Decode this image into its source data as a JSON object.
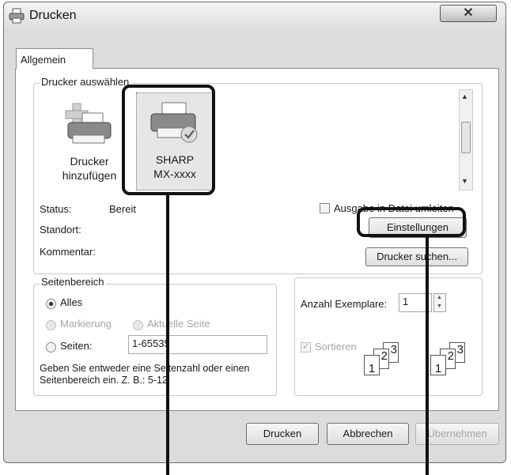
{
  "window": {
    "title": "Drucken"
  },
  "tab": {
    "label": "Allgemein"
  },
  "printer_group": {
    "label": "Drucker auswählen",
    "printers": [
      {
        "name_line1": "Drucker",
        "name_line2": "hinzufügen",
        "icon": "add-printer-icon"
      },
      {
        "name_line1": "SHARP",
        "name_line2": "MX-xxxx",
        "icon": "printer-default-icon"
      }
    ]
  },
  "status": {
    "status_label": "Status:",
    "status_value": "Bereit",
    "location_label": "Standort:",
    "comment_label": "Kommentar:"
  },
  "print_to_file": {
    "label": "Ausgabe in Datei umleiten"
  },
  "buttons": {
    "settings": "Einstellungen",
    "find_printer": "Drucker suchen...",
    "print": "Drucken",
    "cancel": "Abbrechen",
    "apply": "Übernehmen"
  },
  "page_range": {
    "label": "Seitenbereich",
    "all": "Alles",
    "selection": "Markierung",
    "current_page": "Aktuelle Seite",
    "pages": "Seiten:",
    "pages_value": "1-65535",
    "hint": "Geben Sie entweder eine Seitenzahl oder einen Seitenbereich ein. Z. B.: 5-12"
  },
  "copies": {
    "label": "Anzahl Exemplare:",
    "value": "1",
    "collate": "Sortieren",
    "collate_glyphs": [
      "1",
      "2",
      "3"
    ]
  }
}
